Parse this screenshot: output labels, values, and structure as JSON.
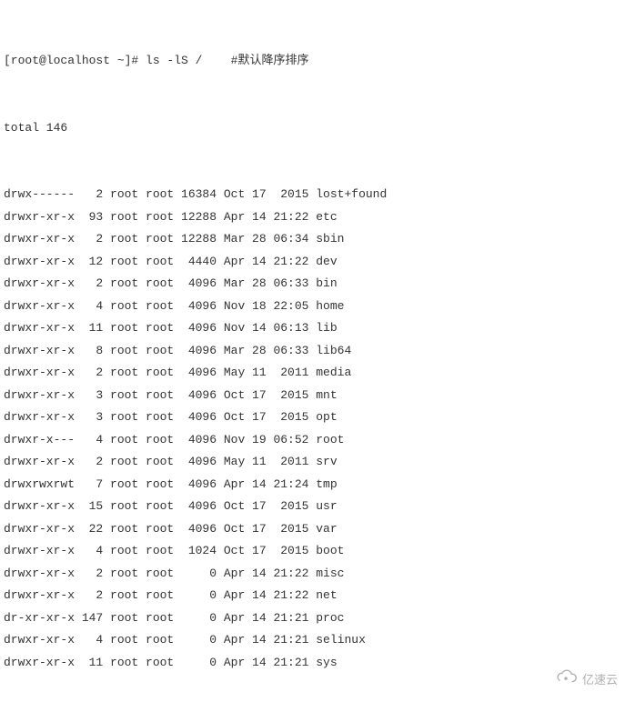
{
  "prompt": "[root@localhost ~]# ",
  "command": "ls -lS /",
  "comment": "    #默认降序排序",
  "total_line": "total 146",
  "listing": [
    {
      "perm": "drwx------",
      "links": "  2",
      "owner": "root",
      "group": "root",
      "size": "16384",
      "date": "Oct 17  2015",
      "name": "lost+found"
    },
    {
      "perm": "drwxr-xr-x",
      "links": " 93",
      "owner": "root",
      "group": "root",
      "size": "12288",
      "date": "Apr 14 21:22",
      "name": "etc"
    },
    {
      "perm": "drwxr-xr-x",
      "links": "  2",
      "owner": "root",
      "group": "root",
      "size": "12288",
      "date": "Mar 28 06:34",
      "name": "sbin"
    },
    {
      "perm": "drwxr-xr-x",
      "links": " 12",
      "owner": "root",
      "group": "root",
      "size": " 4440",
      "date": "Apr 14 21:22",
      "name": "dev"
    },
    {
      "perm": "drwxr-xr-x",
      "links": "  2",
      "owner": "root",
      "group": "root",
      "size": " 4096",
      "date": "Mar 28 06:33",
      "name": "bin"
    },
    {
      "perm": "drwxr-xr-x",
      "links": "  4",
      "owner": "root",
      "group": "root",
      "size": " 4096",
      "date": "Nov 18 22:05",
      "name": "home"
    },
    {
      "perm": "drwxr-xr-x",
      "links": " 11",
      "owner": "root",
      "group": "root",
      "size": " 4096",
      "date": "Nov 14 06:13",
      "name": "lib"
    },
    {
      "perm": "drwxr-xr-x",
      "links": "  8",
      "owner": "root",
      "group": "root",
      "size": " 4096",
      "date": "Mar 28 06:33",
      "name": "lib64"
    },
    {
      "perm": "drwxr-xr-x",
      "links": "  2",
      "owner": "root",
      "group": "root",
      "size": " 4096",
      "date": "May 11  2011",
      "name": "media"
    },
    {
      "perm": "drwxr-xr-x",
      "links": "  3",
      "owner": "root",
      "group": "root",
      "size": " 4096",
      "date": "Oct 17  2015",
      "name": "mnt"
    },
    {
      "perm": "drwxr-xr-x",
      "links": "  3",
      "owner": "root",
      "group": "root",
      "size": " 4096",
      "date": "Oct 17  2015",
      "name": "opt"
    },
    {
      "perm": "drwxr-x---",
      "links": "  4",
      "owner": "root",
      "group": "root",
      "size": " 4096",
      "date": "Nov 19 06:52",
      "name": "root"
    },
    {
      "perm": "drwxr-xr-x",
      "links": "  2",
      "owner": "root",
      "group": "root",
      "size": " 4096",
      "date": "May 11  2011",
      "name": "srv"
    },
    {
      "perm": "drwxrwxrwt",
      "links": "  7",
      "owner": "root",
      "group": "root",
      "size": " 4096",
      "date": "Apr 14 21:24",
      "name": "tmp"
    },
    {
      "perm": "drwxr-xr-x",
      "links": " 15",
      "owner": "root",
      "group": "root",
      "size": " 4096",
      "date": "Oct 17  2015",
      "name": "usr"
    },
    {
      "perm": "drwxr-xr-x",
      "links": " 22",
      "owner": "root",
      "group": "root",
      "size": " 4096",
      "date": "Oct 17  2015",
      "name": "var"
    },
    {
      "perm": "drwxr-xr-x",
      "links": "  4",
      "owner": "root",
      "group": "root",
      "size": " 1024",
      "date": "Oct 17  2015",
      "name": "boot"
    },
    {
      "perm": "drwxr-xr-x",
      "links": "  2",
      "owner": "root",
      "group": "root",
      "size": "    0",
      "date": "Apr 14 21:22",
      "name": "misc"
    },
    {
      "perm": "drwxr-xr-x",
      "links": "  2",
      "owner": "root",
      "group": "root",
      "size": "    0",
      "date": "Apr 14 21:22",
      "name": "net"
    },
    {
      "perm": "dr-xr-xr-x",
      "links": "147",
      "owner": "root",
      "group": "root",
      "size": "    0",
      "date": "Apr 14 21:21",
      "name": "proc"
    },
    {
      "perm": "drwxr-xr-x",
      "links": "  4",
      "owner": "root",
      "group": "root",
      "size": "    0",
      "date": "Apr 14 21:21",
      "name": "selinux"
    },
    {
      "perm": "drwxr-xr-x",
      "links": " 11",
      "owner": "root",
      "group": "root",
      "size": "    0",
      "date": "Apr 14 21:21",
      "name": "sys"
    }
  ],
  "watermark_text": "亿速云"
}
